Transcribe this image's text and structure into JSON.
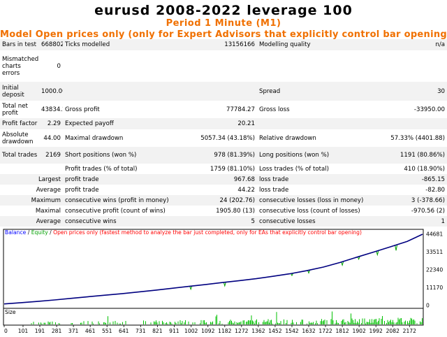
{
  "header": {
    "title": "eurusd 2008-2022  leverage 100",
    "period": "Period  1 Minute (M1)",
    "model": "Model  Open prices only (only for Expert Advisors that explicitly control bar opening)"
  },
  "report": {
    "bars_in_test_label": "Bars in test",
    "bars_in_test": "6688023",
    "ticks_modelled_label": "Ticks modelled",
    "ticks_modelled": "13156166",
    "modelling_quality_label": "Modelling quality",
    "modelling_quality": "n/a",
    "mismatched_label": "Mismatched charts errors",
    "mismatched": "0",
    "initial_deposit_label": "Initial deposit",
    "initial_deposit": "1000.00",
    "spread_label": "Spread",
    "spread": "30",
    "total_net_profit_label": "Total net profit",
    "total_net_profit": "43834.27",
    "gross_profit_label": "Gross profit",
    "gross_profit": "77784.27",
    "gross_loss_label": "Gross loss",
    "gross_loss": "-33950.00",
    "profit_factor_label": "Profit factor",
    "profit_factor": "2.29",
    "expected_payoff_label": "Expected payoff",
    "expected_payoff": "20.21",
    "absolute_drawdown_label": "Absolute drawdown",
    "absolute_drawdown": "44.00",
    "maximal_drawdown_label": "Maximal drawdown",
    "maximal_drawdown": "5057.34 (43.18%)",
    "relative_drawdown_label": "Relative drawdown",
    "relative_drawdown": "57.33% (4401.88)",
    "total_trades_label": "Total trades",
    "total_trades": "2169",
    "short_positions_label": "Short positions (won %)",
    "short_positions": "978 (81.39%)",
    "long_positions_label": "Long positions (won %)",
    "long_positions": "1191 (80.86%)",
    "profit_trades_label": "Profit trades (% of total)",
    "profit_trades": "1759 (81.10%)",
    "loss_trades_label": "Loss trades (% of total)",
    "loss_trades": "410 (18.90%)",
    "largest_label": "Largest",
    "largest_profit_label": "profit trade",
    "largest_profit": "967.68",
    "largest_loss_label": "loss trade",
    "largest_loss": "-865.15",
    "average_label": "Average",
    "average_profit_label": "profit trade",
    "average_profit": "44.22",
    "average_loss_label": "loss trade",
    "average_loss": "-82.80",
    "maximum_label": "Maximum",
    "max_cons_wins_label": "consecutive wins (profit in money)",
    "max_cons_wins": "24 (202.76)",
    "max_cons_losses_label": "consecutive losses (loss in money)",
    "max_cons_losses": "3 (-378.66)",
    "maximal_label": "Maximal",
    "maximal_cons_profit_label": "consecutive profit (count of wins)",
    "maximal_cons_profit": "1905.80 (13)",
    "maximal_cons_loss_label": "consecutive loss (count of losses)",
    "maximal_cons_loss": "-970.56 (2)",
    "average2_label": "Average",
    "avg_cons_wins_label": "consecutive wins",
    "avg_cons_wins": "5",
    "avg_cons_losses_label": "consecutive losses",
    "avg_cons_losses": "1"
  },
  "chart_data": {
    "type": "line",
    "legend": [
      {
        "text": "Balance",
        "color": "#0000ff"
      },
      {
        "text": " / ",
        "color": "#000000"
      },
      {
        "text": "Equity",
        "color": "#00a000"
      },
      {
        "text": " / ",
        "color": "#000000"
      },
      {
        "text": "Open prices only (fastest method to analyze the bar just completed, only for EAs that explicitly control bar opening)",
        "color": "#ff0000"
      }
    ],
    "y_ticks": [
      "44681",
      "33511",
      "22340",
      "11170",
      "0"
    ],
    "ylim": [
      0,
      44681
    ],
    "x_ticks": [
      "0",
      "101",
      "191",
      "281",
      "371",
      "461",
      "551",
      "641",
      "731",
      "821",
      "911",
      "1002",
      "1092",
      "1182",
      "1272",
      "1362",
      "1452",
      "1542",
      "1632",
      "1722",
      "1812",
      "1902",
      "1992",
      "2082",
      "2172"
    ],
    "xlim": [
      0,
      2242
    ],
    "size_label": "Size",
    "colors": {
      "balance": "#000080",
      "equity": "#00a000",
      "volume": "#00c000"
    },
    "series": [
      {
        "name": "Balance",
        "x": [
          0,
          90,
          180,
          270,
          360,
          450,
          540,
          630,
          720,
          810,
          900,
          990,
          1080,
          1170,
          1260,
          1350,
          1440,
          1530,
          1620,
          1710,
          1800,
          1890,
          1980,
          2070,
          2160,
          2242
        ],
        "values": [
          1000,
          1800,
          2600,
          3500,
          4500,
          5500,
          6500,
          7400,
          8500,
          9600,
          10800,
          12000,
          13200,
          14400,
          15600,
          16800,
          18300,
          19900,
          21800,
          24100,
          27000,
          30300,
          33500,
          36800,
          40200,
          44681
        ]
      },
      {
        "name": "Equity",
        "dips": [
          [
            1000,
            10200
          ],
          [
            1182,
            12300
          ],
          [
            1542,
            18800
          ],
          [
            1632,
            20400
          ],
          [
            1812,
            25300
          ],
          [
            1900,
            29000
          ],
          [
            2000,
            31800
          ],
          [
            2100,
            34500
          ]
        ]
      }
    ]
  }
}
